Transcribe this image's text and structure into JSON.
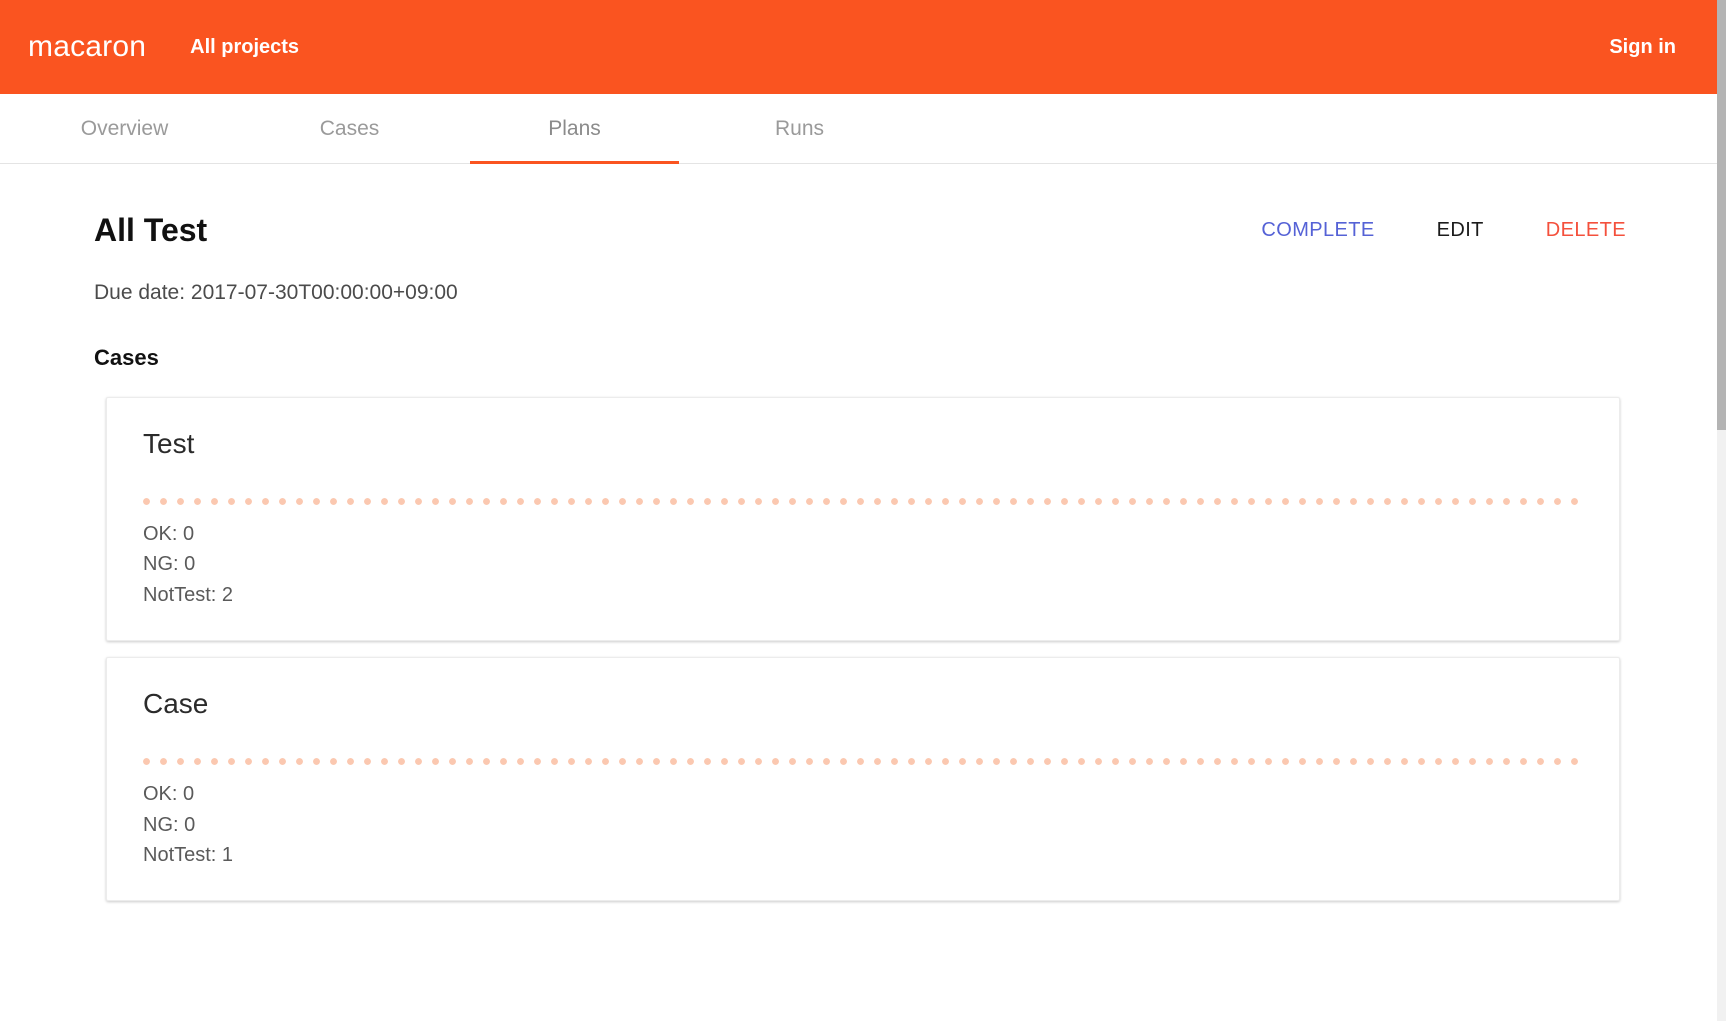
{
  "header": {
    "brand": "macaron",
    "all_projects_label": "All projects",
    "signin_label": "Sign in",
    "background_color": "#fa5420"
  },
  "tabs": [
    {
      "label": "Overview",
      "active": false
    },
    {
      "label": "Cases",
      "active": false
    },
    {
      "label": "Plans",
      "active": true
    },
    {
      "label": "Runs",
      "active": false
    }
  ],
  "plan": {
    "title": "All Test",
    "due_date": "Due date: 2017-07-30T00:00:00+09:00",
    "actions": {
      "complete_label": "COMPLETE",
      "edit_label": "EDIT",
      "delete_label": "DELETE",
      "complete_color": "#5562d6",
      "edit_color": "#1b1b1b",
      "delete_color": "#f4503c"
    }
  },
  "cases_section": {
    "heading": "Cases",
    "cards": [
      {
        "title": "Test",
        "ok": "OK: 0",
        "ng": "NG: 0",
        "nottest": "NotTest: 2"
      },
      {
        "title": "Case",
        "ok": "OK: 0",
        "ng": "NG: 0",
        "nottest": "NotTest: 1"
      }
    ],
    "divider_color": "#fbc8b0"
  }
}
